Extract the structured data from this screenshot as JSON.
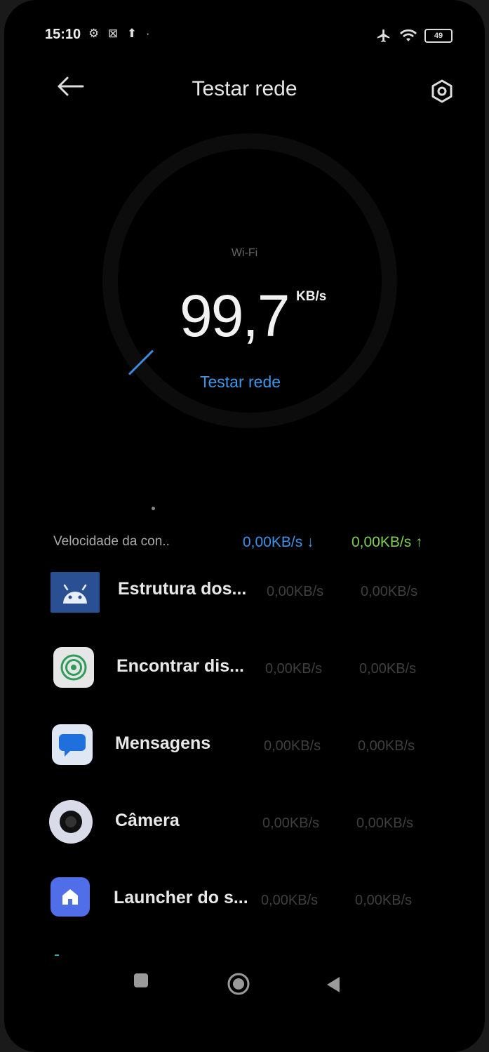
{
  "status_bar": {
    "time": "15:10",
    "icons_left": "⚙ ⊠ ⬆ ·",
    "battery": "49"
  },
  "header": {
    "title": "Testar rede"
  },
  "gauge": {
    "network": "Wi-Fi",
    "speed": "99,7",
    "unit": "KB/s"
  },
  "test_button": {
    "label": "Testar rede"
  },
  "speed_summary": {
    "label": "Velocidade da con..",
    "download": "0,00KB/s ↓",
    "upload": "0,00KB/s ↑"
  },
  "apps": [
    {
      "name": "Estrutura dos...",
      "down": "0,00KB/s",
      "up": "0,00KB/s",
      "icon": "android-icon"
    },
    {
      "name": "Encontrar dis...",
      "down": "0,00KB/s",
      "up": "0,00KB/s",
      "icon": "find-device-icon"
    },
    {
      "name": "Mensagens",
      "down": "0,00KB/s",
      "up": "0,00KB/s",
      "icon": "messages-icon"
    },
    {
      "name": "Câmera",
      "down": "0,00KB/s",
      "up": "0,00KB/s",
      "icon": "camera-icon"
    },
    {
      "name": "Launcher do s...",
      "down": "0,00KB/s",
      "up": "0,00KB/s",
      "icon": "launcher-icon"
    }
  ],
  "colors": {
    "accent_blue": "#3d95e8",
    "upload_green": "#7fce52",
    "background": "#000000"
  }
}
